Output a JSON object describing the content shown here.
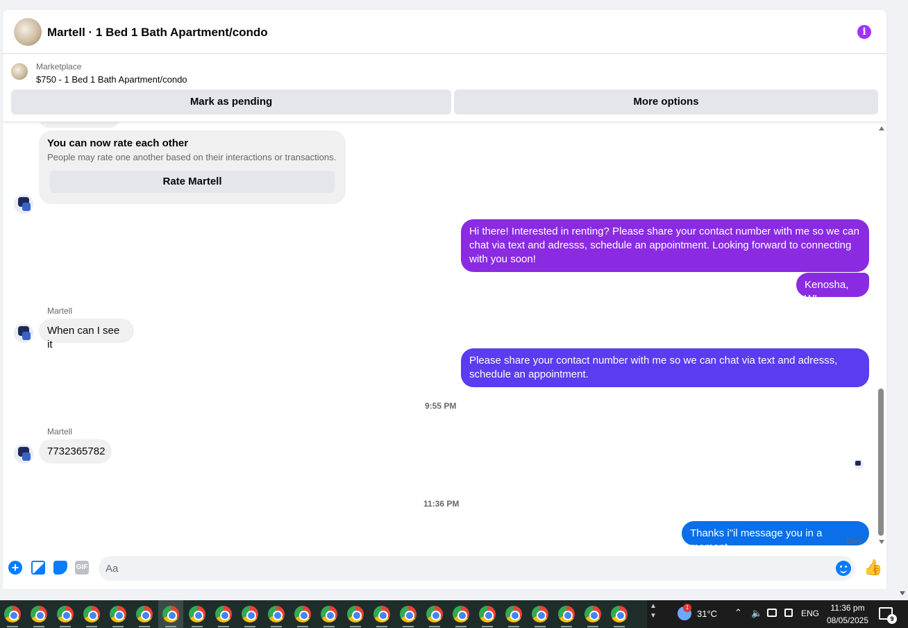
{
  "header": {
    "title": "Martell · 1 Bed 1 Bath Apartment/condo",
    "info_icon": "i"
  },
  "listing": {
    "label": "Marketplace",
    "price_title": "$750 - 1 Bed 1 Bath Apartment/condo",
    "mark_pending": "Mark as pending",
    "more_options": "More options"
  },
  "rating_card": {
    "title": "You can now rate each other",
    "subtitle": "People may rate one another based on their interactions or transactions.",
    "button": "Rate Martell"
  },
  "messages": {
    "m1": "Hi there! Interested in renting? Please share your contact number with me so we can chat via text and adresss, schedule an appointment. Looking forward to connecting with you soon!",
    "m2": "Kenosha, WI",
    "sender1": "Martell",
    "m3": "When can I see it",
    "m4": "Please share your contact number with me so we can chat via text and adresss, schedule an appointment.",
    "time1": "9:55 PM",
    "sender2": "Martell",
    "m5": "7732365782",
    "time2": "11:36 PM",
    "m6": "Thanks i\"il message you in a moment",
    "status": "Sent"
  },
  "composer": {
    "placeholder": "Aa",
    "gif_label": "GIF"
  },
  "colors": {
    "bubble_purple": "#8a2be2",
    "bubble_indigo": "#5b3cf0",
    "bubble_blue": "#0a6fe8",
    "accent": "#0a7cff"
  },
  "taskbar": {
    "temperature": "31°C",
    "language": "ENG",
    "time": "11:36 pm",
    "date": "08/05/2025",
    "weather_badge": "1",
    "notification_count": "9",
    "app_count": 24
  }
}
